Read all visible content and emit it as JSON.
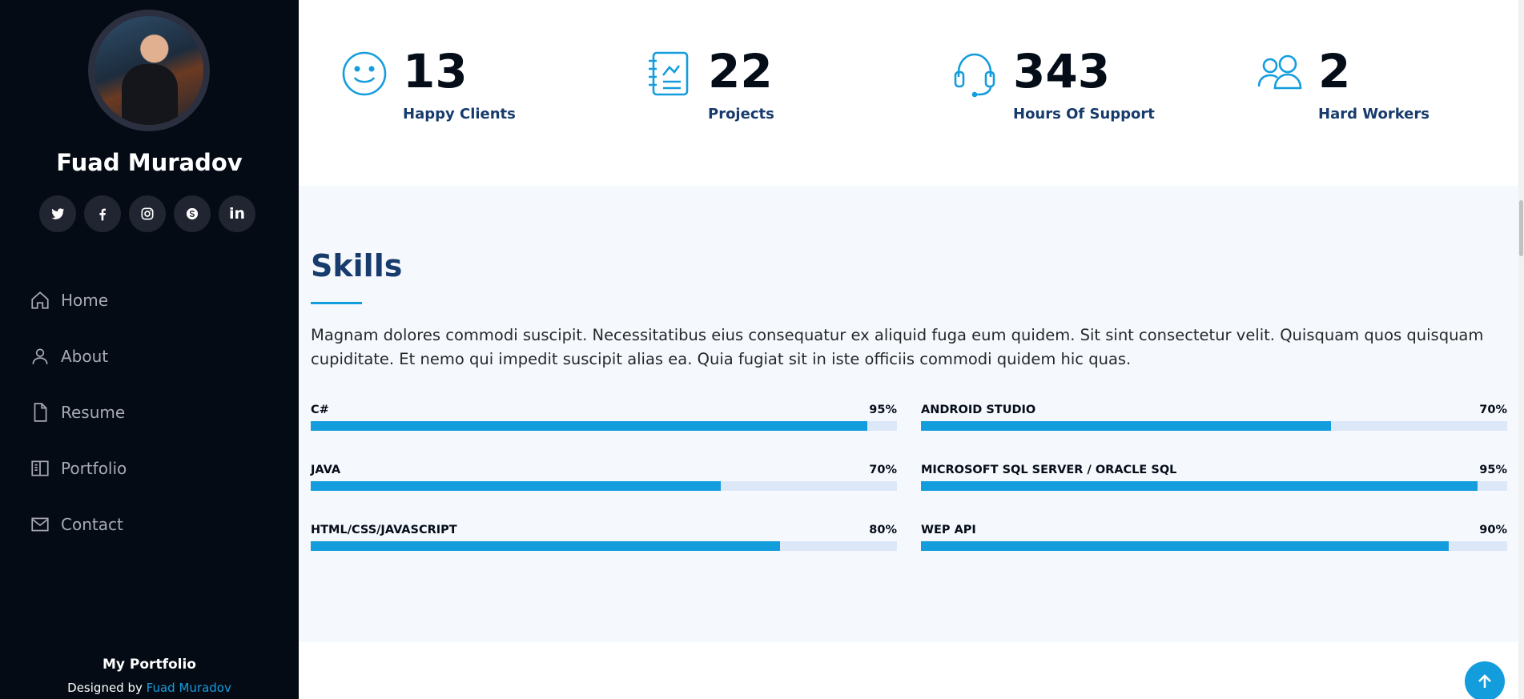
{
  "profile": {
    "name": "Fuad Muradov"
  },
  "social": [
    {
      "icon": "twitter-icon",
      "label": "twitter"
    },
    {
      "icon": "facebook-icon",
      "label": "facebook"
    },
    {
      "icon": "instagram-icon",
      "label": "instagram"
    },
    {
      "icon": "skype-icon",
      "label": "skype"
    },
    {
      "icon": "linkedin-icon",
      "label": "in"
    }
  ],
  "nav": [
    {
      "label": "Home",
      "icon": "house-icon"
    },
    {
      "label": "About",
      "icon": "person-icon"
    },
    {
      "label": "Resume",
      "icon": "file-icon"
    },
    {
      "label": "Portfolio",
      "icon": "book-half-icon"
    },
    {
      "label": "Contact",
      "icon": "envelope-icon"
    }
  ],
  "sidebar_footer": {
    "title": "My Portfolio",
    "designed_by": "Designed by",
    "author_link": "Fuad Muradov"
  },
  "facts": [
    {
      "value": "13",
      "label": "Happy Clients",
      "icon": "emoji-smile-icon"
    },
    {
      "value": "22",
      "label": "Projects",
      "icon": "journal-richtext-icon"
    },
    {
      "value": "343",
      "label": "Hours Of Support",
      "icon": "headset-icon"
    },
    {
      "value": "2",
      "label": "Hard Workers",
      "icon": "people-icon"
    }
  ],
  "skills": {
    "title": "Skills",
    "description": "Magnam dolores commodi suscipit. Necessitatibus eius consequatur ex aliquid fuga eum quidem. Sit sint consectetur velit. Quisquam quos quisquam cupiditate. Et nemo qui impedit suscipit alias ea. Quia fugiat sit in iste officiis commodi quidem hic quas.",
    "items": [
      {
        "name": "C#",
        "value": "95%",
        "percent": 95
      },
      {
        "name": "ANDROID STUDIO",
        "value": "70%",
        "percent": 70
      },
      {
        "name": "JAVA",
        "value": "70%",
        "percent": 70
      },
      {
        "name": "MICROSOFT SQL SERVER / ORACLE SQL",
        "value": "95%",
        "percent": 95
      },
      {
        "name": "HTML/CSS/JAVASCRIPT",
        "value": "80%",
        "percent": 80
      },
      {
        "name": "WEP API",
        "value": "90%",
        "percent": 90
      }
    ]
  },
  "colors": {
    "accent": "#149ddd",
    "sidebar_bg": "#040b14",
    "heading": "#173b6c"
  }
}
